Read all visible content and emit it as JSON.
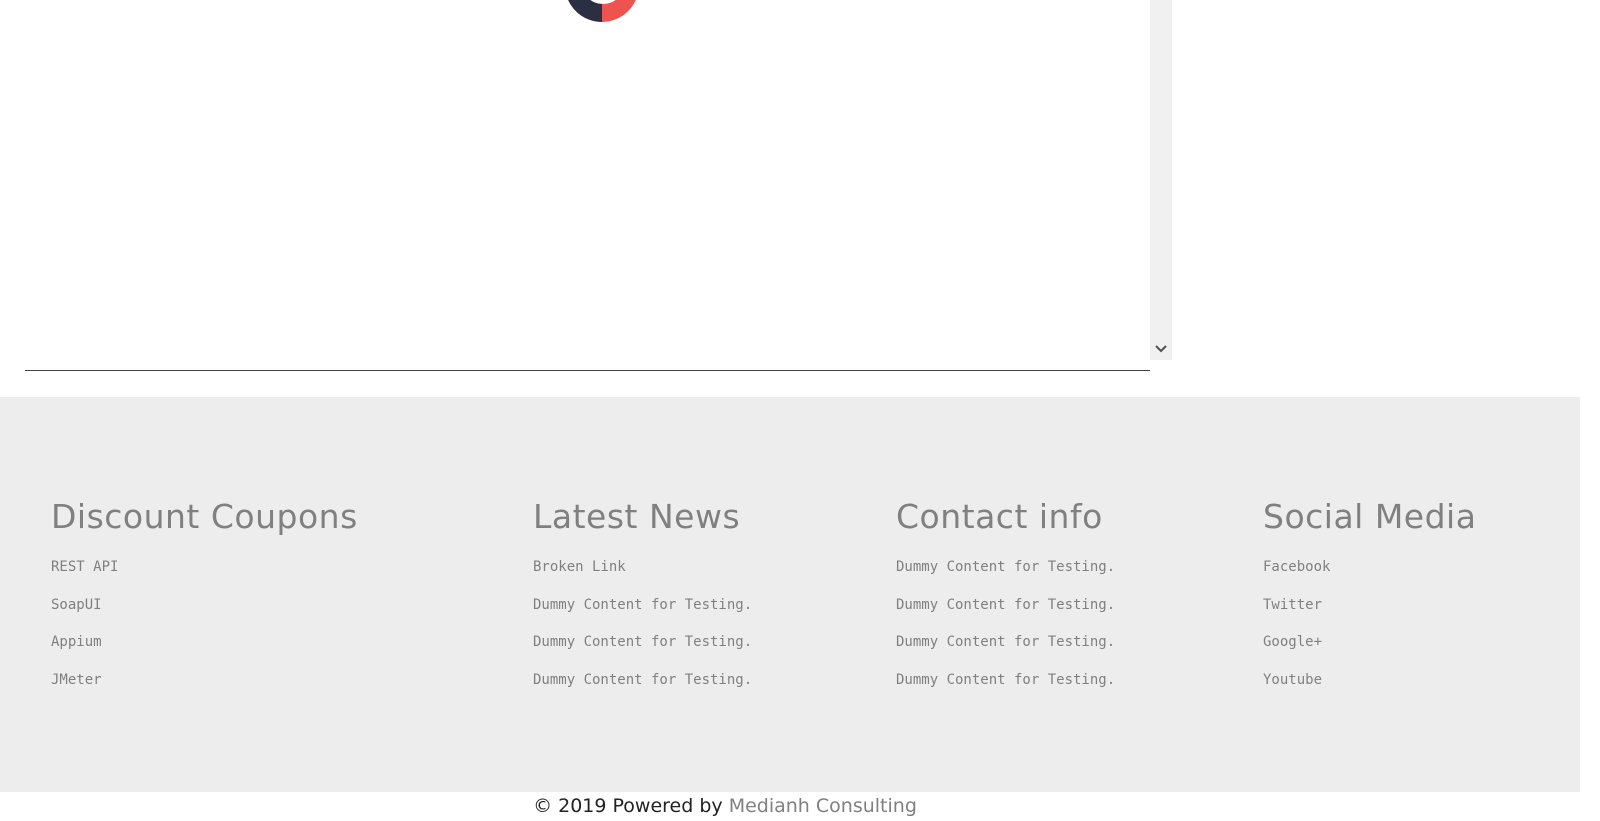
{
  "scrollbar": {
    "arrow_icon": "chevron-down-icon",
    "arrow_glyph": "⌄"
  },
  "footer": {
    "columns": [
      {
        "heading": "Discount Coupons",
        "items": [
          "REST API",
          "SoapUI",
          "Appium",
          "JMeter"
        ]
      },
      {
        "heading": "Latest News",
        "items": [
          "Broken Link",
          "Dummy Content for Testing.",
          "Dummy Content for Testing.",
          "Dummy Content for Testing."
        ]
      },
      {
        "heading": "Contact info",
        "items": [
          "Dummy Content for Testing.",
          "Dummy Content for Testing.",
          "Dummy Content for Testing.",
          "Dummy Content for Testing."
        ]
      },
      {
        "heading": "Social Media",
        "items": [
          "Facebook",
          "Twitter",
          "Google+",
          "Youtube"
        ]
      }
    ],
    "copyright_prefix": "© 2019 Powered by ",
    "company": "Medianh Consulting"
  },
  "colors": {
    "footer_bg": "#ededed",
    "text_gray": "#808080",
    "logo_red": "#ee5350",
    "logo_dark": "#2b2f44"
  }
}
